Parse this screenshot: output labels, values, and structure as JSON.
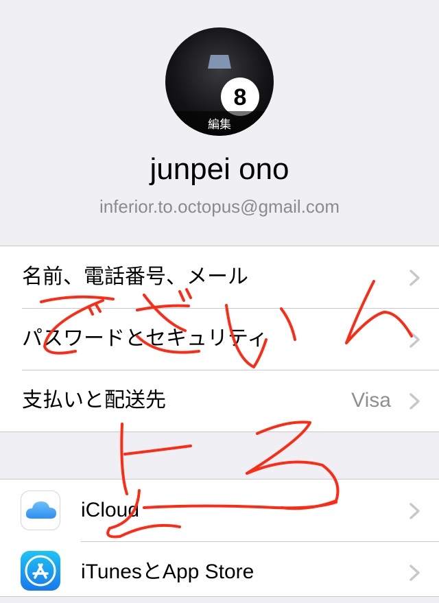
{
  "profile": {
    "edit_label": "編集",
    "name": "junpei ono",
    "email": "inferior.to.octopus@gmail.com",
    "avatar_ball_number": "8"
  },
  "settings": {
    "group1": [
      {
        "label": "名前、電話番号、メール",
        "value": ""
      },
      {
        "label": "パスワードとセキュリティ",
        "value": ""
      },
      {
        "label": "支払いと配送先",
        "value": "Visa"
      }
    ],
    "group2": [
      {
        "label": "iCloud",
        "icon": "icloud-icon"
      },
      {
        "label": "iTunesとApp Store",
        "icon": "app-store-icon"
      }
    ]
  },
  "colors": {
    "background": "#efeff4",
    "cell": "#ffffff",
    "separator": "#c8c7cc",
    "chevron": "#c7c7cc",
    "secondary_text": "#8e8e93",
    "scribble": "#ff2a14",
    "icloud_blue": "#3ea0f5",
    "app_store_blue": "#1a8cf0"
  }
}
